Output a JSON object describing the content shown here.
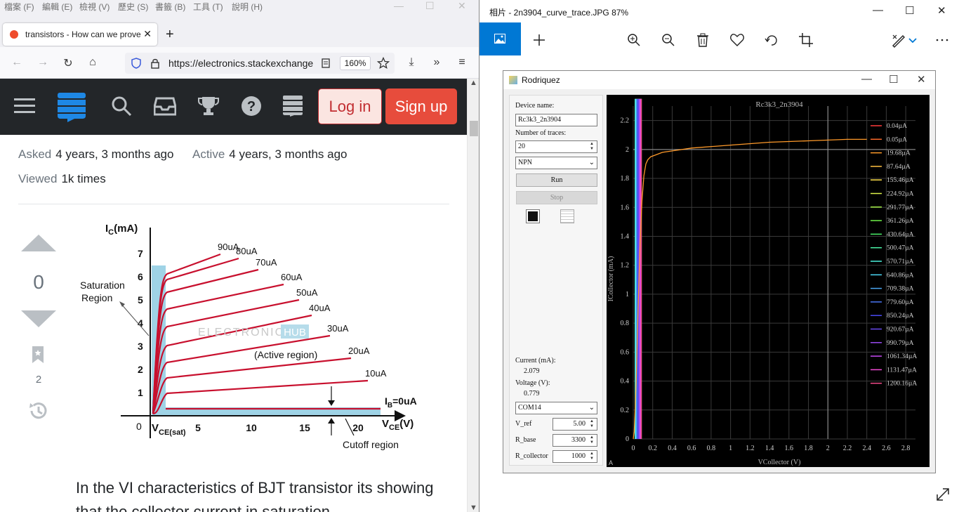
{
  "browser": {
    "menu": [
      "檔案 (F)",
      "編輯 (E)",
      "檢視 (V)",
      "歷史 (S)",
      "書籤 (B)",
      "工具 (T)",
      "說明 (H)"
    ],
    "tab_title": "transistors - How can we prove",
    "url": "https://electronics.stackexchange",
    "zoom": "160%"
  },
  "site_header": {
    "login": "Log in",
    "signup": "Sign up"
  },
  "question_meta": {
    "asked_label": "Asked",
    "asked_value": "4 years, 3 months ago",
    "active_label": "Active",
    "active_value": "4 years, 3 months ago",
    "viewed_label": "Viewed",
    "viewed_value": "1k times"
  },
  "votes": {
    "score": "0",
    "bookmarks": "2"
  },
  "bjt_figure": {
    "y_axis_label": "I",
    "y_axis_sub": "C",
    "y_axis_unit": "(mA)",
    "y_ticks": [
      "1",
      "2",
      "3",
      "4",
      "5",
      "6",
      "7"
    ],
    "x_ticks": [
      "5",
      "10",
      "15",
      "20"
    ],
    "origin": "0",
    "vce_sat_main": "V",
    "vce_sat_sub": "CE(sat)",
    "vce_main": "V",
    "vce_sub": "CE",
    "vce_unit": "(V)",
    "curve_labels": [
      "90uA",
      "80uA",
      "70uA",
      "60uA",
      "50uA",
      "40uA",
      "30uA",
      "20uA",
      "10uA"
    ],
    "ib_main": "I",
    "ib_sub": "B",
    "ib_value": "=0uA",
    "saturation_line1": "Saturation",
    "saturation_line2": "Region",
    "active_region": "(Active region)",
    "cutoff_region": "Cutoff region",
    "watermark_1": "ELECTRONICS",
    "watermark_2": "HUB"
  },
  "paragraph": "In the VI characteristics of BJT transistor its showing that the collector current in saturation",
  "photos": {
    "title": "相片 - 2n3904_curve_trace.JPG   87%"
  },
  "rodriquez": {
    "title": "Rodriquez",
    "device_name_label": "Device name:",
    "device_name_value": "Rc3k3_2n3904",
    "traces_label": "Number of traces:",
    "traces_value": "20",
    "type_value": "NPN",
    "run_label": "Run",
    "stop_label": "Stop",
    "current_label": "Current (mA):",
    "current_value": "2.079",
    "voltage_label": "Voltage (V):",
    "voltage_value": "0.779",
    "port_value": "COM14",
    "vref_label": "V_ref",
    "vref_value": "5.00",
    "rbase_label": "R_base",
    "rbase_value": "3300",
    "rcoll_label": "R_collector",
    "rcoll_value": "1000"
  },
  "chart_data": {
    "type": "line",
    "title": "Rc3k3_2n3904",
    "xlabel": "VCollector (V)",
    "ylabel": "ICollector (mA)",
    "xlim": [
      0,
      2.9
    ],
    "ylim": [
      0,
      2.3
    ],
    "x_ticks": [
      "0",
      "0.2",
      "0.4",
      "0.6",
      "0.8",
      "1",
      "1.2",
      "1.4",
      "1.6",
      "1.8",
      "2",
      "2.2",
      "2.4",
      "2.6",
      "2.8"
    ],
    "y_ticks": [
      "0",
      "0.2",
      "0.4",
      "0.6",
      "0.8",
      "1",
      "1.2",
      "1.4",
      "1.6",
      "1.8",
      "2",
      "2.2"
    ],
    "grid": true,
    "legend_position": "right",
    "series": [
      {
        "name": "0.04µA",
        "color": "#ff3b3b"
      },
      {
        "name": "0.05µA",
        "color": "#ff6a2a"
      },
      {
        "name": "19.68µA",
        "color": "#ff9a2a",
        "x": [
          0,
          0.01,
          0.03,
          0.05,
          0.07,
          0.09,
          0.11,
          0.13,
          0.15,
          0.18,
          0.22,
          0.3,
          0.4,
          0.6,
          1.0,
          1.4,
          1.8,
          2.2,
          2.4
        ],
        "y": [
          0,
          0.05,
          0.4,
          0.9,
          1.35,
          1.65,
          1.82,
          1.9,
          1.93,
          1.95,
          1.96,
          1.98,
          1.99,
          2.01,
          2.03,
          2.05,
          2.06,
          2.07,
          2.07
        ]
      },
      {
        "name": "87.64µA",
        "color": "#ffc040"
      },
      {
        "name": "155.46µA",
        "color": "#ffe04a"
      },
      {
        "name": "224.92µA",
        "color": "#ddf24a"
      },
      {
        "name": "291.77µA",
        "color": "#a6f24a"
      },
      {
        "name": "361.26µA",
        "color": "#6ff24a"
      },
      {
        "name": "430.64µA",
        "color": "#4af26a"
      },
      {
        "name": "500.47µA",
        "color": "#4af2a6"
      },
      {
        "name": "570.71µA",
        "color": "#4af2dd"
      },
      {
        "name": "640.86µA",
        "color": "#4ad6f2"
      },
      {
        "name": "709.38µA",
        "color": "#4aa6f2"
      },
      {
        "name": "779.60µA",
        "color": "#4a76f2"
      },
      {
        "name": "850.24µA",
        "color": "#4a4af2"
      },
      {
        "name": "920.67µA",
        "color": "#6a4af2"
      },
      {
        "name": "990.79µA",
        "color": "#9a4af2"
      },
      {
        "name": "1061.34µA",
        "color": "#c64af2"
      },
      {
        "name": "1131.47µA",
        "color": "#f24ad6"
      },
      {
        "name": "1200.16µA",
        "color": "#f24a8a"
      }
    ]
  }
}
